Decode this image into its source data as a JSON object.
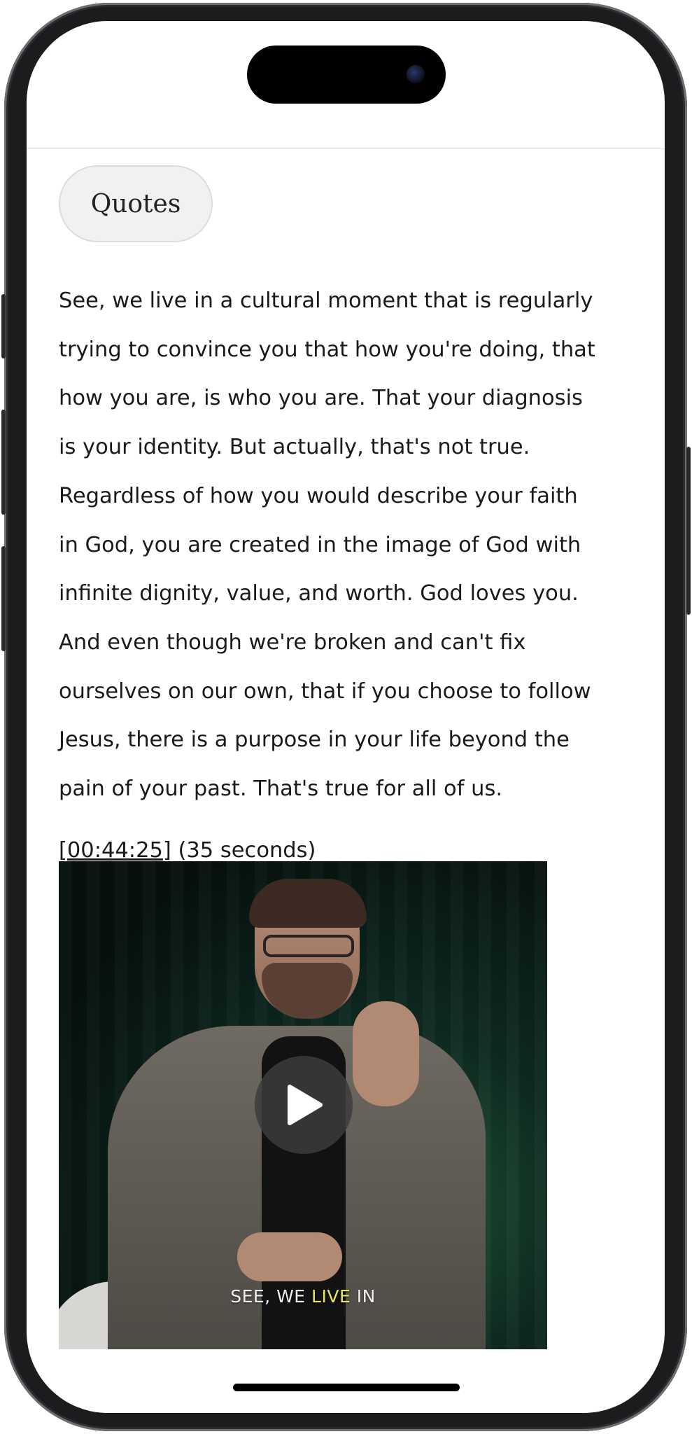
{
  "chip": {
    "label": "Quotes"
  },
  "quote": {
    "lines": [
      "See, we live in a cultural moment that is regularly",
      "trying to convince you that how you're doing, that",
      "how you are, is who you are. That your diagnosis",
      "is your identity. But actually, that's not true.",
      "Regardless of how you would describe your faith",
      "in God, you are created in the image of God with",
      "infinite dignity, value, and worth. God loves you.",
      "And even though we're broken and can't fix",
      "ourselves on our own, that if you choose to follow",
      "Jesus, there is a purpose in your life beyond the",
      "pain of your past. That's true for all of us."
    ],
    "timestamp_open": "[",
    "timestamp": "00:44:25",
    "timestamp_close": "]",
    "duration": " (35 seconds)"
  },
  "video": {
    "caption_before": "SEE, WE ",
    "caption_highlight": "LIVE",
    "caption_after": " IN",
    "play_icon": "play-icon",
    "caption_highlight_color": "#e8e65a"
  },
  "colors": {
    "background": "#ffffff",
    "text": "#1a1a1a",
    "chip_background": "#f1f1f1"
  }
}
